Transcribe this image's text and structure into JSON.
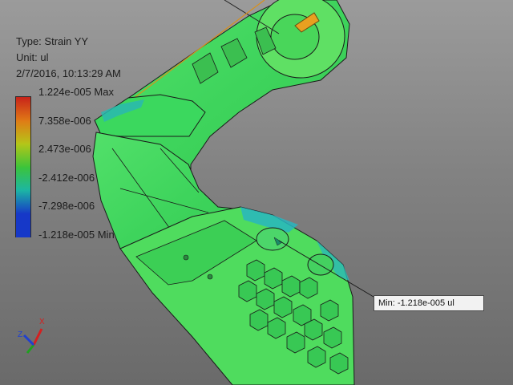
{
  "result_info": {
    "type_line": "Type: Strain YY",
    "unit_line": "Unit: ul",
    "datetime_line": "2/7/2016, 10:13:29 AM"
  },
  "legend": {
    "labels": [
      "1.224e-005 Max",
      "7.358e-006",
      "2.473e-006",
      "-2.412e-006",
      "-7.298e-006",
      "-1.218e-005 Min"
    ],
    "colors": [
      "#c8231a",
      "#e07a16",
      "#b5c618",
      "#3cc43a",
      "#1cb6a4",
      "#1638c8"
    ]
  },
  "min_callout": {
    "text": "Min: -1.218e-005 ul"
  },
  "triad": {
    "x_label": "X",
    "z_label": "Z",
    "x_color": "#d42020",
    "y_color": "#20a020",
    "z_color": "#2040d0"
  }
}
